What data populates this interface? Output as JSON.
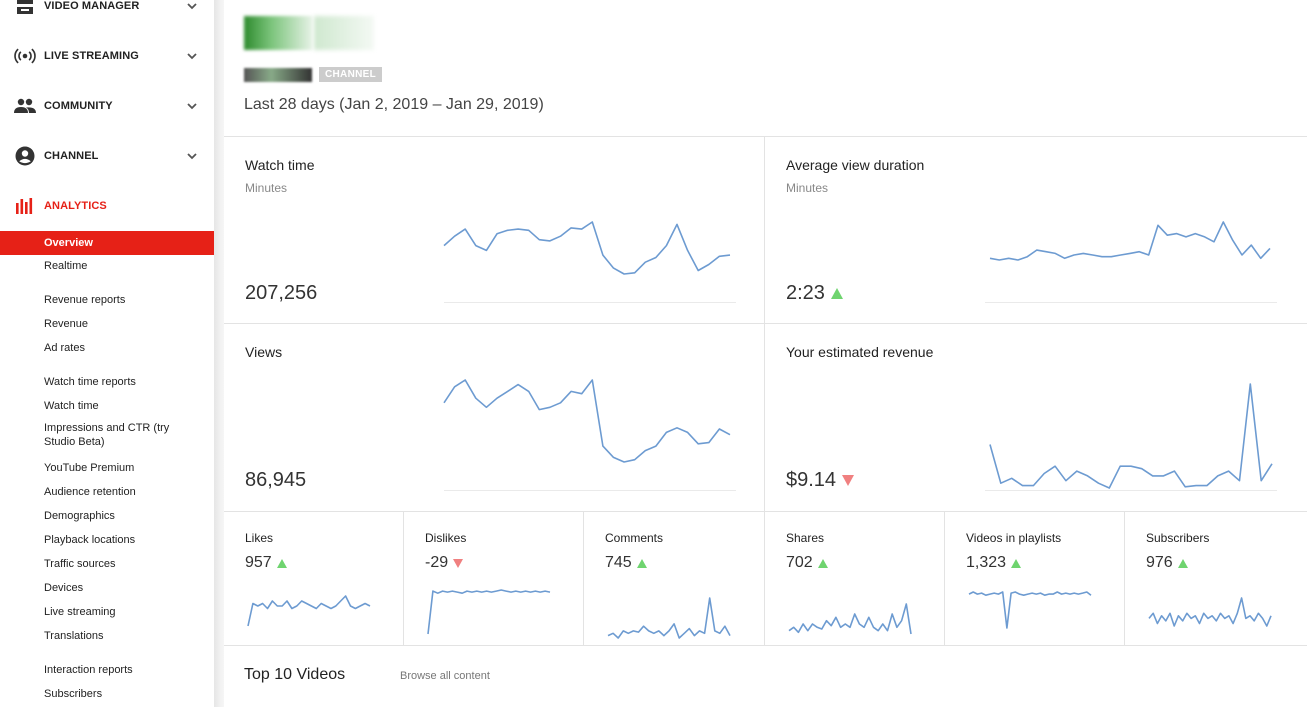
{
  "sidebar": {
    "sections": [
      {
        "label": "VIDEO MANAGER",
        "icon": "video-manager-icon"
      },
      {
        "label": "LIVE STREAMING",
        "icon": "live-streaming-icon"
      },
      {
        "label": "COMMUNITY",
        "icon": "community-icon"
      },
      {
        "label": "CHANNEL",
        "icon": "channel-icon"
      },
      {
        "label": "ANALYTICS",
        "icon": "analytics-icon"
      }
    ],
    "items": [
      "Overview",
      "Realtime",
      "Revenue reports",
      "Revenue",
      "Ad rates",
      "Watch time reports",
      "Watch time",
      "Impressions and CTR (try Studio Beta)",
      "YouTube Premium",
      "Audience retention",
      "Demographics",
      "Playback locations",
      "Traffic sources",
      "Devices",
      "Live streaming",
      "Translations",
      "Interaction reports",
      "Subscribers"
    ]
  },
  "header": {
    "badge": "CHANNEL",
    "date_range": "Last 28 days (Jan 2, 2019 – Jan 29, 2019)"
  },
  "cards": {
    "watch_time": {
      "title": "Watch time",
      "subtitle": "Minutes",
      "value": "207,256"
    },
    "avg_duration": {
      "title": "Average view duration",
      "subtitle": "Minutes",
      "value": "2:23",
      "trend": "up"
    },
    "views": {
      "title": "Views",
      "value": "86,945"
    },
    "revenue": {
      "title": "Your estimated revenue",
      "value": "$9.14",
      "trend": "down"
    }
  },
  "small_cards": [
    {
      "title": "Likes",
      "value": "957",
      "trend": "up"
    },
    {
      "title": "Dislikes",
      "value": "-29",
      "trend": "down"
    },
    {
      "title": "Comments",
      "value": "745",
      "trend": "up"
    },
    {
      "title": "Shares",
      "value": "702",
      "trend": "up"
    },
    {
      "title": "Videos in playlists",
      "value": "1,323",
      "trend": "up"
    },
    {
      "title": "Subscribers",
      "value": "976",
      "trend": "up"
    }
  ],
  "footer": {
    "top10": "Top 10 Videos",
    "browse": "Browse all content"
  },
  "colors": {
    "accent_red": "#e62117",
    "sparkline": "#6d9bd1",
    "trend_up": "#6fd46f",
    "trend_down": "#f08080"
  },
  "sparklines": {
    "watch_time": [
      52,
      60,
      66,
      52,
      48,
      62,
      65,
      66,
      65,
      57,
      56,
      60,
      67,
      66,
      72,
      44,
      33,
      28,
      29,
      38,
      42,
      52,
      70,
      48,
      31,
      36,
      43,
      44
    ],
    "avg_duration": [
      40,
      39,
      40,
      39,
      41,
      45,
      44,
      43,
      40,
      42,
      43,
      42,
      41,
      41,
      42,
      43,
      44,
      42,
      60,
      54,
      55,
      53,
      55,
      53,
      50,
      62,
      51,
      42,
      48,
      40,
      46
    ],
    "views": [
      78,
      92,
      98,
      82,
      74,
      82,
      88,
      94,
      88,
      72,
      74,
      78,
      88,
      86,
      98,
      40,
      30,
      26,
      28,
      36,
      40,
      52,
      56,
      52,
      42,
      43,
      55,
      50
    ],
    "revenue": [
      40,
      8,
      12,
      6,
      6,
      16,
      22,
      10,
      18,
      14,
      8,
      4,
      22,
      22,
      20,
      14,
      14,
      18,
      5,
      6,
      6,
      14,
      18,
      10,
      90,
      10,
      24
    ],
    "likes": [
      4,
      22,
      20,
      22,
      18,
      24,
      20,
      20,
      24,
      18,
      20,
      24,
      22,
      20,
      18,
      22,
      20,
      18,
      20,
      24,
      28,
      20,
      18,
      20,
      22,
      20
    ],
    "dislikes": [
      2,
      42,
      40,
      42,
      41,
      42,
      41,
      40,
      42,
      41,
      42,
      41,
      42,
      41,
      42,
      43,
      42,
      41,
      42,
      41,
      42,
      41,
      42,
      41,
      42,
      41
    ],
    "comments": [
      8,
      10,
      6,
      12,
      10,
      12,
      11,
      16,
      12,
      10,
      12,
      8,
      12,
      18,
      6,
      10,
      14,
      8,
      12,
      10,
      40,
      12,
      10,
      16,
      8
    ],
    "shares": [
      10,
      12,
      9,
      14,
      10,
      14,
      12,
      11,
      16,
      13,
      18,
      12,
      14,
      12,
      20,
      14,
      12,
      18,
      12,
      10,
      14,
      10,
      20,
      12,
      16,
      26,
      8
    ],
    "playlists": [
      36,
      38,
      36,
      37,
      35,
      36,
      37,
      36,
      38,
      4,
      37,
      38,
      36,
      35,
      36,
      37,
      36,
      37,
      35,
      36,
      36,
      38,
      36,
      37,
      36,
      37,
      36,
      37,
      38,
      35
    ],
    "subscribers": [
      18,
      22,
      14,
      20,
      16,
      22,
      12,
      20,
      16,
      22,
      18,
      20,
      14,
      22,
      18,
      20,
      16,
      22,
      18,
      20,
      14,
      22,
      34,
      18,
      20,
      16,
      22,
      18,
      12,
      20
    ]
  }
}
